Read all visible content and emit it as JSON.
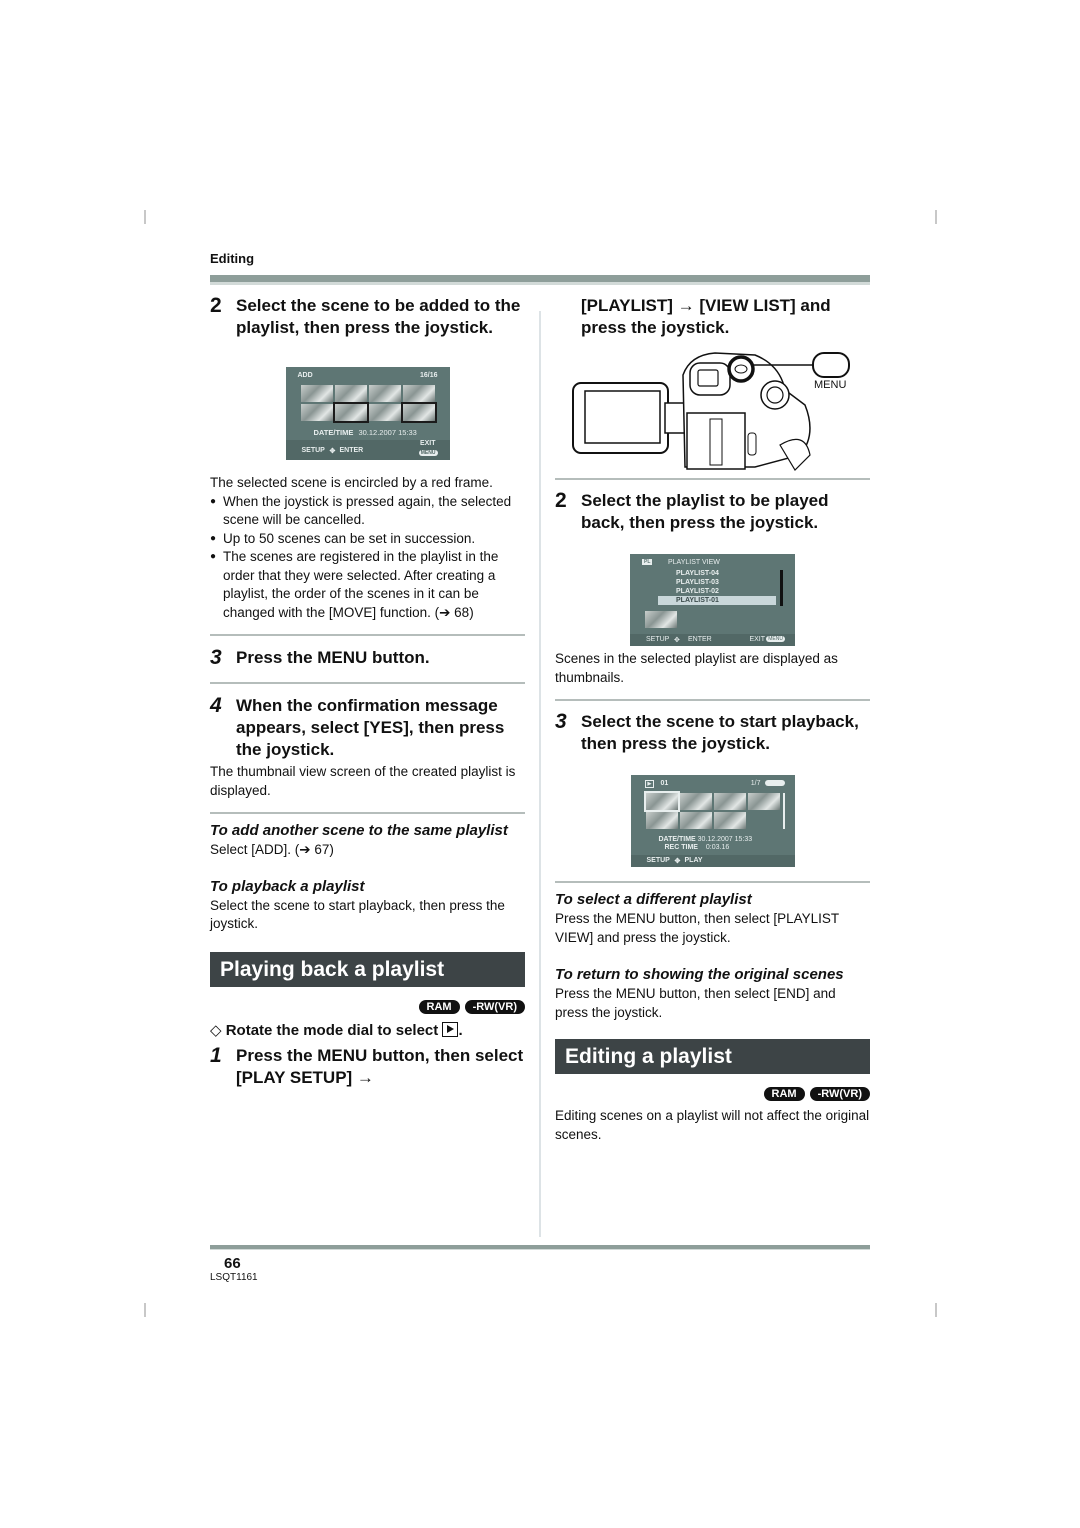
{
  "header": {
    "section": "Editing"
  },
  "left_column": {
    "step2": {
      "number": "2",
      "text": "Select the scene to be added to the playlist, then press the joystick."
    },
    "add_screen": {
      "mode_label": "ADD",
      "counter": "16/16",
      "date_label": "DATE/TIME",
      "date_value": "30.12.2007  15:33",
      "setup_label": "SETUP",
      "enter_label": "ENTER",
      "exit_label": "EXIT",
      "menu_label": "MENU"
    },
    "selected_note": "The selected scene is encircled by a red frame.",
    "bullets": [
      "When the joystick is pressed again, the selected scene will be cancelled.",
      "Up to 50 scenes can be set in succession.",
      "The scenes are registered in the playlist in the order that they were selected. After creating a playlist, the order of the scenes in it can be changed with the [MOVE] function. (➔ 68)"
    ],
    "step3": {
      "number": "3",
      "text": "Press the MENU button."
    },
    "step4": {
      "number": "4",
      "text": "When the confirmation message appears, select [YES], then press the joystick."
    },
    "step4_note": "The thumbnail view screen of the created playlist is displayed.",
    "add_another": {
      "heading": "To add another scene to the same playlist",
      "text": "Select [ADD]. (➔ 67)"
    },
    "playback": {
      "heading": "To playback a playlist",
      "text": "Select the scene to start playback, then press the joystick."
    },
    "banner": "Playing back a playlist",
    "badges": [
      "RAM",
      "-RW(VR)"
    ],
    "rotate_note": {
      "prefix": "◇",
      "text": "Rotate the mode dial to select",
      "suffix": "."
    },
    "step1": {
      "number": "1",
      "text": "Press the MENU button, then select [PLAY SETUP] →"
    }
  },
  "right_column": {
    "step1_cont": "[PLAYLIST] → [VIEW LIST] and press the joystick.",
    "camera": {
      "menu_label": "MENU"
    },
    "step2": {
      "number": "2",
      "text": "Select the playlist to be played back, then press the joystick."
    },
    "playlist_screen": {
      "title": "PLAYLIST VIEW",
      "items": [
        "PLAYLIST-04",
        "PLAYLIST-03",
        "PLAYLIST-02",
        "PLAYLIST-01"
      ],
      "selected": "PLAYLIST-01",
      "setup_label": "SETUP",
      "enter_label": "ENTER",
      "exit_label": "EXIT",
      "menu_label": "MENU"
    },
    "step2_note": "Scenes in the selected playlist are displayed as thumbnails.",
    "step3": {
      "number": "3",
      "text": "Select the scene to start playback, then press the joystick."
    },
    "play_screen": {
      "playlist_id": "01",
      "counter": "1/7",
      "date_label": "DATE/TIME",
      "date_value": "30.12.2007  15:33",
      "rec_label": "REC TIME",
      "rec_value": "0:03.16",
      "setup_label": "SETUP",
      "play_label": "PLAY"
    },
    "different": {
      "heading": "To select a different playlist",
      "text": "Press the MENU button, then select [PLAYLIST VIEW] and press the joystick."
    },
    "return": {
      "heading": "To return to showing the original scenes",
      "text": "Press the MENU button, then select [END] and press the joystick."
    },
    "banner": "Editing a playlist",
    "badges": [
      "RAM",
      "-RW(VR)"
    ],
    "editing_note": "Editing scenes on a playlist will not affect the original scenes."
  },
  "footer": {
    "page_number": "66",
    "doc_code": "LSQT1161"
  }
}
